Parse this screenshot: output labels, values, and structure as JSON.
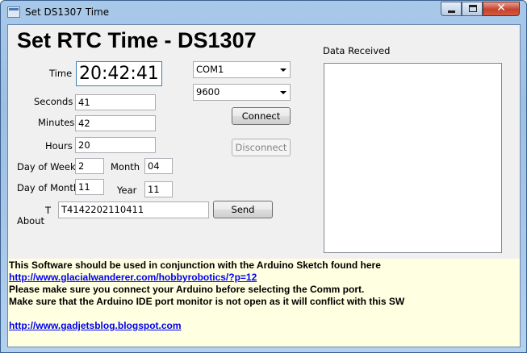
{
  "window": {
    "title": "Set DS1307 Time",
    "controls": {
      "minimize": "minimize",
      "maximize": "maximize",
      "close": "✕"
    }
  },
  "heading": "Set RTC Time - DS1307",
  "fields": {
    "time_label": "Time",
    "time_value": "20:42:41",
    "seconds_label": "Seconds",
    "seconds_value": "41",
    "minutes_label": "Minutes",
    "minutes_value": "42",
    "hours_label": "Hours",
    "hours_value": "20",
    "day_of_week_label": "Day of Week",
    "day_of_week_value": "2",
    "month_label": "Month",
    "month_value": "04",
    "day_of_month_label": "Day of Month",
    "day_of_month_value": "11",
    "year_label": "Year",
    "year_value": "11",
    "t_label": "T",
    "about_label": "About",
    "command_value": "T4142202110411"
  },
  "serial": {
    "port_selected": "COM1",
    "baud_selected": "9600",
    "connect_label": "Connect",
    "disconnect_label": "Disconnect",
    "send_label": "Send"
  },
  "data_received_label": "Data Received",
  "info": {
    "line1": "This Software should be used in conjunction with the Arduino Sketch found here",
    "link1": "http://www.glacialwanderer.com/hobbyrobotics/?p=12",
    "line2": "Please make sure you connect your Arduino before selecting the Comm port.",
    "line3": "Make sure that the Arduino IDE port monitor is not open as it will conflict with this SW",
    "link2": "http://www.gadjetsblog.blogspot.com"
  }
}
